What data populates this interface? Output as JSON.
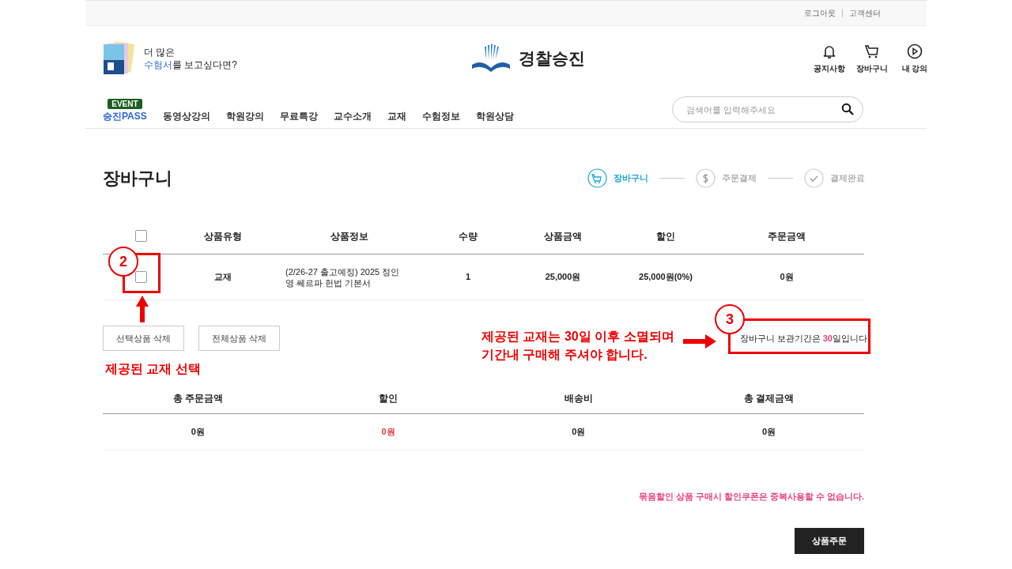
{
  "top_links": [
    "로그아웃",
    "고객센터"
  ],
  "promo": {
    "line1": "더 많은",
    "line2": "**수험서**를 보고싶다면?"
  },
  "logo": {
    "text": "경찰승진"
  },
  "header_icons": [
    {
      "kind": "bell",
      "label": "공지사항"
    },
    {
      "kind": "cart",
      "label": "장바구니"
    },
    {
      "kind": "play",
      "label": "내 강의"
    }
  ],
  "nav": [
    {
      "label": "승진PASS",
      "badge": "EVENT",
      "highlight": true
    },
    {
      "label": "동영상강의",
      "highlight": false
    },
    {
      "label": "학원강의",
      "highlight": false
    },
    {
      "label": "무료특강",
      "highlight": false
    },
    {
      "label": "교수소개",
      "highlight": false
    },
    {
      "label": "교재",
      "highlight": false
    },
    {
      "label": "수험정보",
      "highlight": false
    },
    {
      "label": "학원상담",
      "highlight": false
    }
  ],
  "search": {
    "placeholder": "검색어를 입력해주세요"
  },
  "page_title": "장바구니",
  "steps": [
    {
      "kind": "cart",
      "label": "장바구니",
      "selected": true
    },
    {
      "kind": "dollar",
      "label": "주문결제",
      "selected": false
    },
    {
      "kind": "check",
      "label": "결제완료",
      "selected": false
    }
  ],
  "cart_table": {
    "select_all_checked": false,
    "columns": [
      "상품유형",
      "상품정보",
      "수량",
      "상품금액",
      "할인",
      "주문금액"
    ],
    "rows": [
      {
        "checked": false,
        "type": "교재",
        "info": "(2/26-27 출고예정) 2025 정인영 쎄르파 헌법 기본서",
        "qty": "1",
        "price": "25,000원",
        "discount": "25,000원(0%)",
        "total": "0원"
      }
    ]
  },
  "buttons": [
    "선택상품 삭제",
    "전체상품 삭제"
  ],
  "retention": "장바구니 보관기간은 **30**일입니다",
  "summary": {
    "columns": [
      "총 주문금액",
      "할인",
      "배송비",
      "총 결제금액"
    ],
    "values": [
      {
        "text": "0원",
        "accent": false
      },
      {
        "text": "0원",
        "accent": true
      },
      {
        "text": "0원",
        "accent": false
      },
      {
        "text": "0원",
        "accent": false
      }
    ]
  },
  "notice": "묶음할인 상품 구매시 할인쿠폰은 중복사용할 수 없습니다.",
  "order_button": "상품주문",
  "annotations": [
    {
      "number": "2",
      "label": "제공된 교재 선택"
    },
    {
      "number": "3",
      "label": "제공된 교재는 30일 이후 소멸되며\n기간내 구매해 주셔야 합니다."
    }
  ]
}
